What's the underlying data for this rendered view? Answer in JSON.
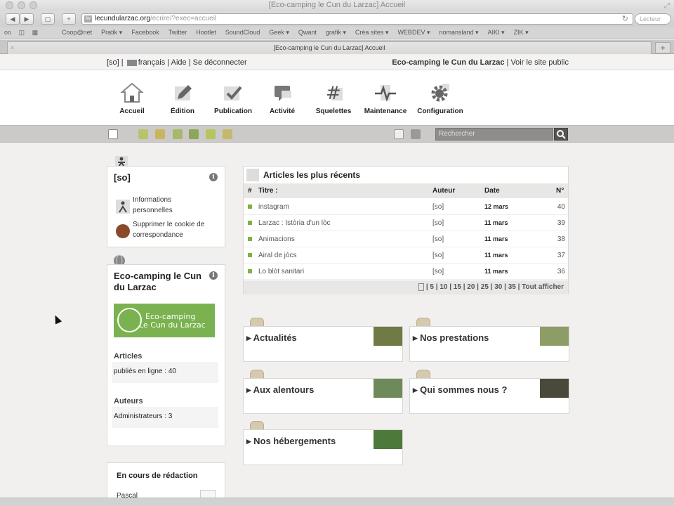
{
  "browser": {
    "window_title": "[Eco-camping le Cun du Larzac] Accueil",
    "url_domain": "lecundularzac.org",
    "url_path": "/ecrire/?exec=accueil",
    "favicon_text": "lw",
    "search_placeholder": "Lecteur",
    "tab_title": "[Eco-camping le Cun du Larzac] Accueil",
    "bookmarks": [
      "Coop@net",
      "Pratik ▾",
      "Facebook",
      "Twitter",
      "Hootlet",
      "SoundCloud",
      "Geek ▾",
      "Qwant",
      "grafik ▾",
      "Créa sites ▾",
      "WEBDEV ▾",
      "nomansland ▾",
      "AIKI ▾",
      "ZIK ▾"
    ]
  },
  "adminbar": {
    "user": "[so]",
    "language": "français",
    "help": "Aide",
    "logout": "Se déconnecter",
    "site_name": "Eco-camping le Cun du Larzac",
    "view_site": "Voir le site public"
  },
  "nav": [
    {
      "label": "Accueil",
      "icon": "home-icon"
    },
    {
      "label": "Édition",
      "icon": "pencil-icon"
    },
    {
      "label": "Publication",
      "icon": "checkmark-icon"
    },
    {
      "label": "Activité",
      "icon": "speech-bubble-icon"
    },
    {
      "label": "Squelettes",
      "icon": "hash-icon"
    },
    {
      "label": "Maintenance",
      "icon": "pulse-icon"
    },
    {
      "label": "Configuration",
      "icon": "gear-icon"
    }
  ],
  "tools": {
    "search_placeholder": "Rechercher"
  },
  "user_box": {
    "title": "[so]",
    "info_link": "Informations personnelles",
    "cookie_link": "Supprimer le cookie de correspondance"
  },
  "site_box": {
    "title": "Eco-camping le Cun du Larzac",
    "logo_line1": "Eco-camping",
    "logo_line2": "Le Cun du Larzac",
    "articles_heading": "Articles",
    "articles_value": "publiés en ligne : 40",
    "authors_heading": "Auteurs",
    "authors_value": "Administrateurs : 3"
  },
  "articles": {
    "title": "Articles les plus récents",
    "columns": {
      "hash": "#",
      "title": "Titre :",
      "author": "Auteur",
      "date": "Date",
      "num": "N°"
    },
    "rows": [
      {
        "title": "instagram",
        "author": "[so]",
        "date": "12 mars",
        "num": "40"
      },
      {
        "title": "Larzac : Istòria d'un lòc",
        "author": "[so]",
        "date": "11 mars",
        "num": "39"
      },
      {
        "title": "Animacions",
        "author": "[so]",
        "date": "11 mars",
        "num": "38"
      },
      {
        "title": "Airal de jòcs",
        "author": "[so]",
        "date": "11 mars",
        "num": "37"
      },
      {
        "title": "Lo blòt sanitari",
        "author": "[so]",
        "date": "11 mars",
        "num": "36"
      }
    ],
    "pagination": "| 5 | 10 | 15 | 20 | 25 | 30 | 35 | Tout afficher"
  },
  "rubriques": [
    {
      "title": "Actualités",
      "thumb_color": "#6f7a45"
    },
    {
      "title": "Nos prestations",
      "thumb_color": "#8e9d66"
    },
    {
      "title": "Aux alentours",
      "thumb_color": "#6e8a5a"
    },
    {
      "title": "Qui sommes nous ?",
      "thumb_color": "#4a4a3a"
    },
    {
      "title": "Nos hébergements",
      "thumb_color": "#4d7a3a"
    }
  ],
  "redaction": {
    "title": "En cours de rédaction",
    "author": "Pascal"
  },
  "colors": {
    "accent_green": "#79b24f",
    "toolbar_grey": "#cbcac8",
    "page_bg": "#f1f0ee"
  }
}
